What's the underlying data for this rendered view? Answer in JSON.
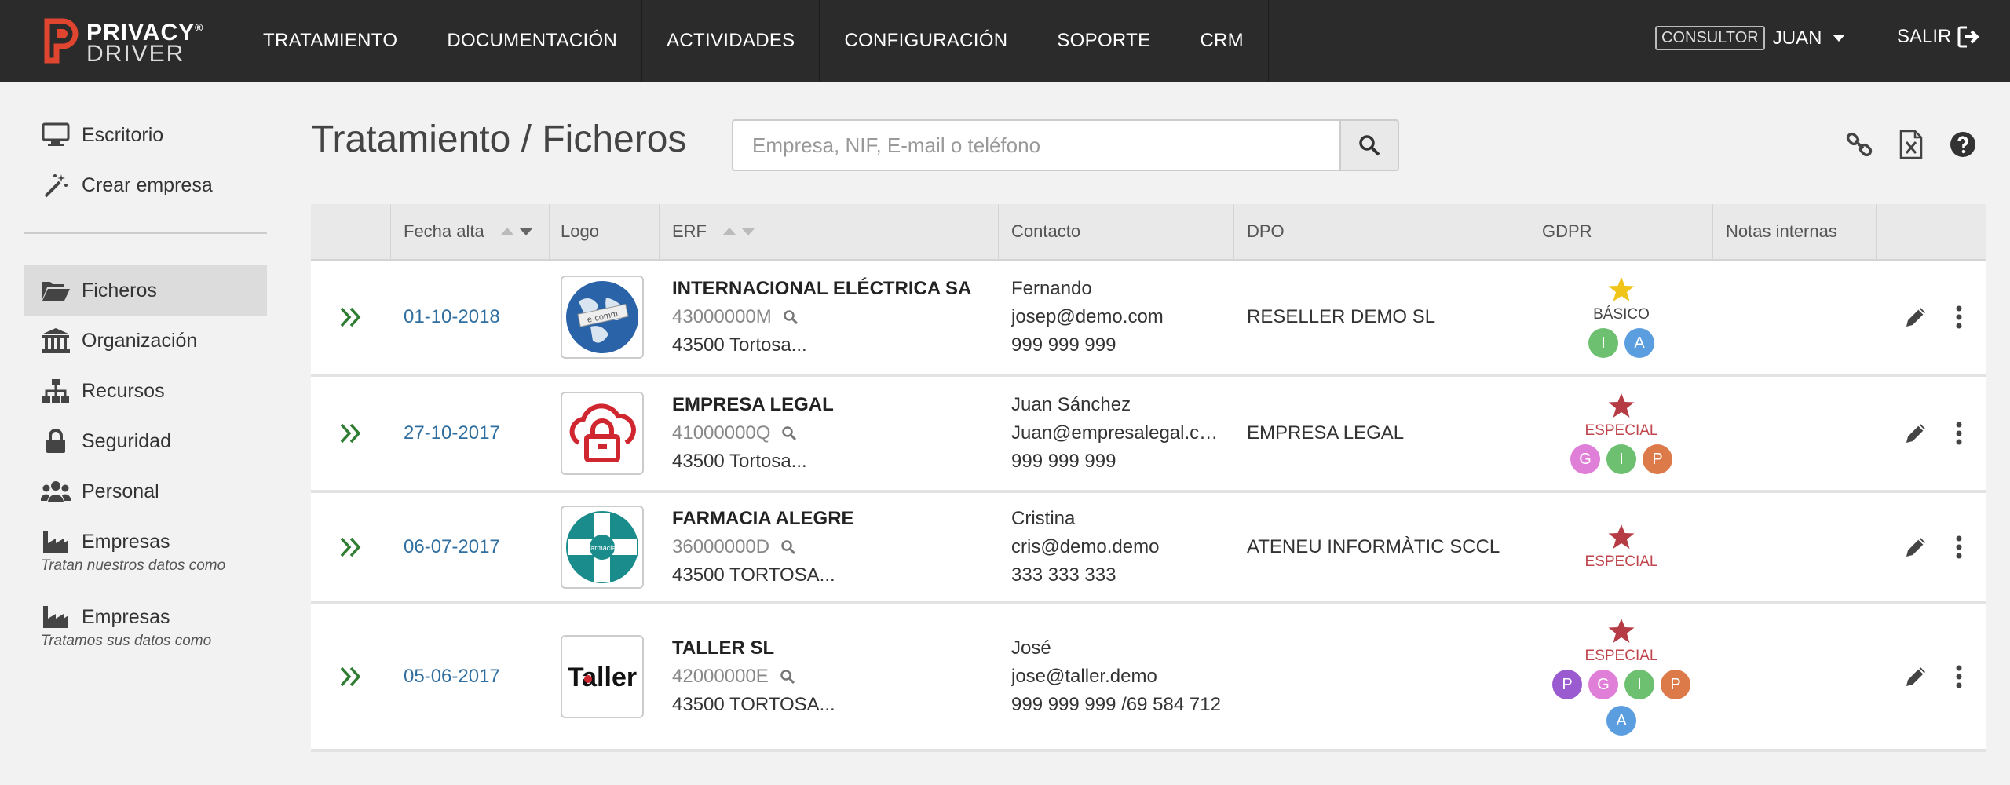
{
  "brand": {
    "line1": "PRIVACY",
    "line2": "DRIVER",
    "reg": "®",
    "accent": "#e0452f"
  },
  "nav": [
    "TRATAMIENTO",
    "DOCUMENTACIÓN",
    "ACTIVIDADES",
    "CONFIGURACIÓN",
    "SOPORTE",
    "CRM"
  ],
  "user": {
    "role": "CONSULTOR",
    "name": "JUAN",
    "logout": "SALIR"
  },
  "sidebar": {
    "top": [
      {
        "label": "Escritorio",
        "icon": "desktop-icon"
      },
      {
        "label": "Crear empresa",
        "icon": "magic-wand-icon"
      }
    ],
    "main": [
      {
        "label": "Ficheros",
        "icon": "folder-open-icon",
        "active": true
      },
      {
        "label": "Organización",
        "icon": "institution-icon"
      },
      {
        "label": "Recursos",
        "icon": "sitemap-icon"
      },
      {
        "label": "Seguridad",
        "icon": "lock-icon"
      },
      {
        "label": "Personal",
        "icon": "users-icon"
      },
      {
        "label": "Empresas",
        "icon": "industry-icon",
        "note": "Tratan nuestros datos como"
      },
      {
        "label": "Empresas",
        "icon": "industry-icon",
        "note": "Tratamos sus datos como"
      }
    ]
  },
  "header": {
    "title": "Tratamiento / Ficheros",
    "search_placeholder": "Empresa, NIF, E-mail o teléfono"
  },
  "table": {
    "columns": [
      "",
      "Fecha alta",
      "Logo",
      "ERF",
      "Contacto",
      "DPO",
      "GDPR",
      "Notas internas",
      ""
    ],
    "rows": [
      {
        "date": "01-10-2018",
        "logo": "globe-logo",
        "name": "INTERNACIONAL ELÉCTRICA SA",
        "nif": "43000000M",
        "address": "43500 Tortosa...",
        "contact_name": "Fernando",
        "contact_email": "josep@demo.com",
        "contact_phone": "999 999 999",
        "dpo": "RESELLER DEMO SL",
        "level": "BÁSICO",
        "level_type": "basic",
        "tags": [
          "I",
          "A"
        ]
      },
      {
        "date": "27-10-2017",
        "logo": "cloud-lock-logo",
        "name": "EMPRESA LEGAL",
        "nif": "41000000Q",
        "address": "43500 Tortosa...",
        "contact_name": "Juan Sánchez",
        "contact_email": "Juan@empresalegal.com",
        "contact_phone": "999 999 999",
        "dpo": "EMPRESA LEGAL",
        "level": "ESPECIAL",
        "level_type": "special",
        "tags": [
          "G",
          "I",
          "P"
        ]
      },
      {
        "date": "06-07-2017",
        "logo": "farmacia-logo",
        "name": "FARMACIA ALEGRE",
        "nif": "36000000D",
        "address": "43500 TORTOSA...",
        "contact_name": "Cristina",
        "contact_email": "cris@demo.demo",
        "contact_phone": "333 333 333",
        "dpo": "ATENEU INFORMÀTIC SCCL",
        "level": "ESPECIAL",
        "level_type": "special",
        "tags": []
      },
      {
        "date": "05-06-2017",
        "logo": "taller-logo",
        "name": "TALLER SL",
        "nif": "42000000E",
        "address": "43500 TORTOSA...",
        "contact_name": "José",
        "contact_email": "jose@taller.demo",
        "contact_phone": "999 999 999 /69 584 712",
        "dpo": "",
        "level": "ESPECIAL",
        "level_type": "special",
        "tags": [
          "P",
          "G",
          "I",
          "P",
          "A"
        ]
      }
    ],
    "logo_texts": {
      "globe": "e-comm",
      "farmacia": "farmacia",
      "taller": "Taller"
    }
  }
}
